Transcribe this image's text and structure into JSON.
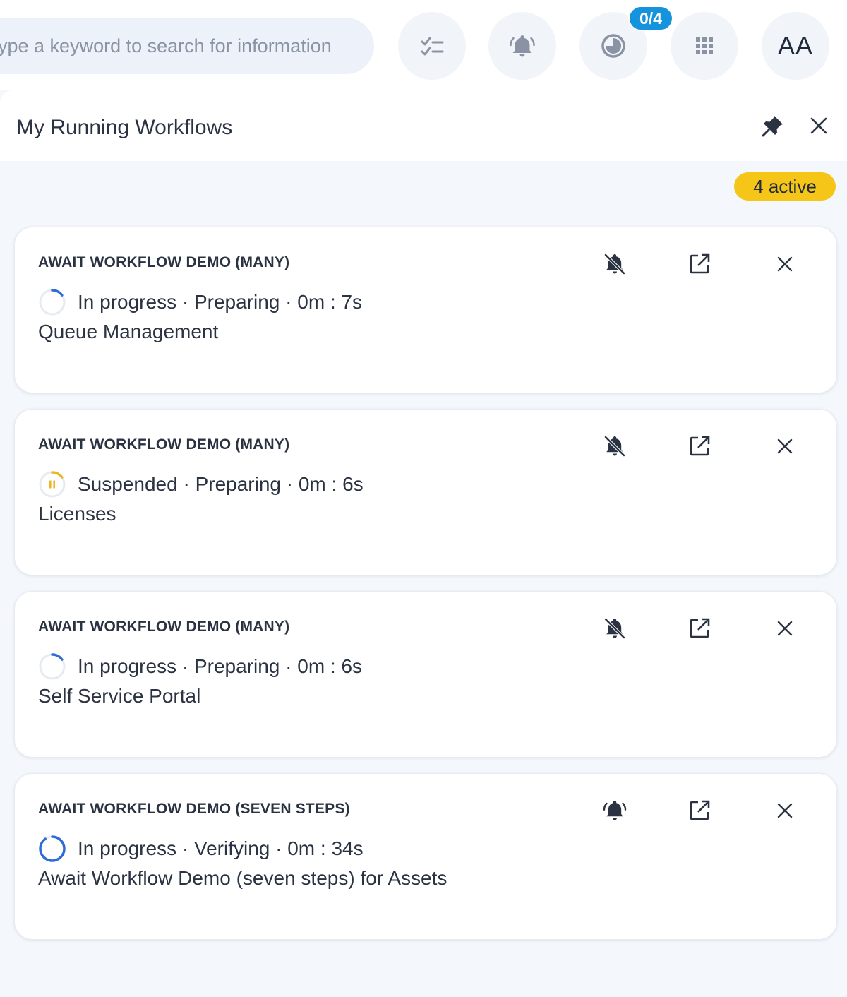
{
  "search": {
    "placeholder": "Type a keyword to search for information"
  },
  "toolbar": {
    "task_count_badge": "0/4",
    "avatar_initials": "AA"
  },
  "panel": {
    "title": "My Running Workflows",
    "active_badge": "4 active"
  },
  "workflows": [
    {
      "title": "AWAIT WORKFLOW DEMO (MANY)",
      "state": "In progress",
      "status_line": "In progress · Preparing · 0m : 7s",
      "subtitle": "Queue Management",
      "notifications": "muted",
      "progress": 0.15
    },
    {
      "title": "AWAIT WORKFLOW DEMO (MANY)",
      "state": "Suspended",
      "status_line": "Suspended · Preparing · 0m : 6s",
      "subtitle": "Licenses",
      "notifications": "muted",
      "progress": 0.15
    },
    {
      "title": "AWAIT WORKFLOW DEMO (MANY)",
      "state": "In progress",
      "status_line": "In progress · Preparing · 0m : 6s",
      "subtitle": "Self Service Portal",
      "notifications": "muted",
      "progress": 0.15
    },
    {
      "title": "AWAIT WORKFLOW DEMO (SEVEN STEPS)",
      "state": "In progress",
      "status_line": "In progress · Verifying · 0m : 34s",
      "subtitle": "Await Workflow Demo (seven steps) for Assets",
      "notifications": "active",
      "progress": 0.9
    }
  ],
  "colors": {
    "in_progress": "#2f6bd8",
    "suspended": "#f0b429",
    "ring_track": "#e6ebf2",
    "active_badge": "#f5c518",
    "count_badge": "#1593dc"
  },
  "icons": {
    "toolbar": [
      "tasks-icon",
      "notification-bell-icon",
      "timer-icon",
      "apps-grid-icon"
    ],
    "panel": [
      "pin-icon",
      "close-icon"
    ],
    "card": [
      "bell-muted-icon",
      "bell-ringing-icon",
      "open-external-icon",
      "close-icon"
    ]
  }
}
